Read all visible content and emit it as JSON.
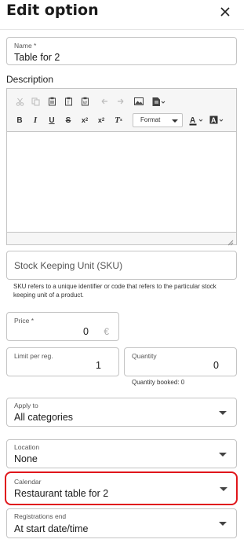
{
  "header": {
    "title": "Edit option",
    "close_icon": "close-icon"
  },
  "name": {
    "label": "Name *",
    "value": "Table for 2"
  },
  "description": {
    "label": "Description",
    "toolbar_row1": [
      "cut-icon",
      "copy-icon",
      "paste-icon",
      "paste-text-icon",
      "paste-word-icon",
      "undo-icon",
      "redo-icon",
      "image-icon",
      "template-icon"
    ],
    "toolbar_row2": [
      "bold-icon",
      "italic-icon",
      "underline-icon",
      "strikethrough-icon",
      "subscript-icon",
      "superscript-icon",
      "remove-format-icon"
    ],
    "format_label": "Format",
    "body_text": ""
  },
  "sku": {
    "placeholder": "Stock Keeping Unit (SKU)",
    "helper": "SKU refers to a unique identifier or code that refers to the particular stock keeping unit of a product."
  },
  "price": {
    "label": "Price *",
    "value": "0",
    "currency": "€"
  },
  "limit_per_reg": {
    "label": "Limit per reg.",
    "value": "1"
  },
  "quantity": {
    "label": "Quantity",
    "value": "0",
    "booked_text": "Quantity booked: 0"
  },
  "apply_to": {
    "label": "Apply to",
    "value": "All categories"
  },
  "location": {
    "label": "Location",
    "value": "None"
  },
  "calendar": {
    "label": "Calendar",
    "value": "Restaurant table for 2",
    "highlight_color": "#e0161b"
  },
  "registrations_end": {
    "label": "Registrations end",
    "value": "At start date/time"
  }
}
